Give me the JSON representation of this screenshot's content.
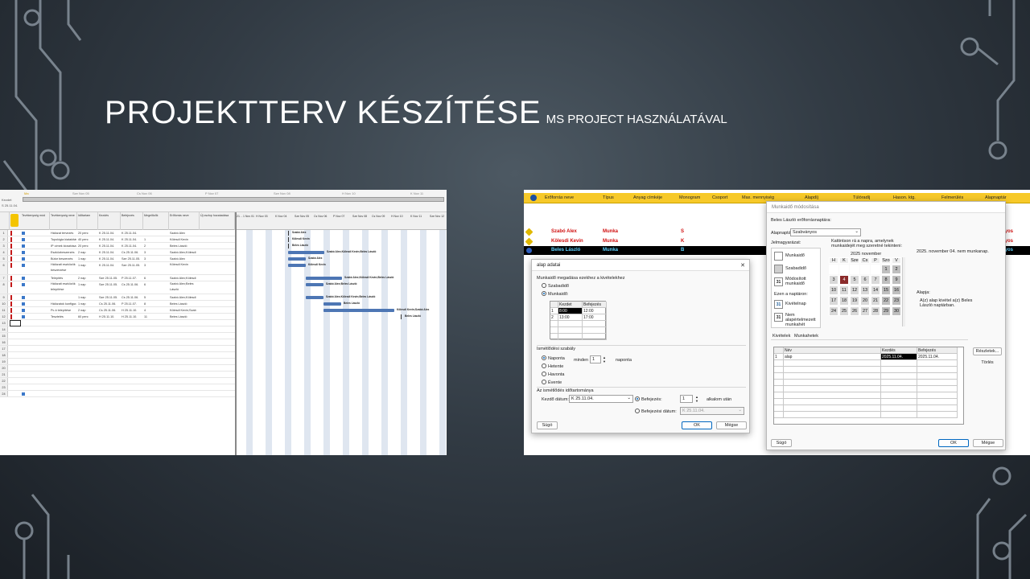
{
  "slide": {
    "title_main": "PROJEKTTERV KÉSZÍTÉSE",
    "title_sub": "MS PROJECT HASZNÁLATÁVAL"
  },
  "left_screenshot": {
    "timeline_start_label": "Kezdet",
    "timeline_start_date": "S 25.11.04.",
    "timeline_dates": [
      "Ma",
      "Sze Nov 05",
      "Cs Nov 06",
      "P Nov 07",
      "Sze Nov 08",
      "H Nov 10",
      "K Nov 11"
    ],
    "columns": [
      "Tevékenység mód",
      "Tevékenység neve",
      "Időtartam",
      "Kezdés",
      "Befejezés",
      "Megelőzők",
      "Erőforrás neve",
      "Új oszlop hozzáadása"
    ],
    "gantt_head": [
      "21. - 1 Nov 01",
      "H Nov 03",
      "K Nov 04",
      "Sze Nov 05",
      "Cs Nov 06",
      "P Nov 07",
      "Sze Nov 08",
      "Cs Nov 09",
      "H Nov 10",
      "K Nov 11",
      "Sze Nov 12"
    ],
    "tasks": [
      {
        "n": "1",
        "name": "Hálózat tervezés",
        "dur": "20 perc",
        "start": "K 25.11.04.",
        "end": "K 25.11.04.",
        "pred": "",
        "res": "Szabó Alex"
      },
      {
        "n": "2",
        "name": "Topológia kialakítása",
        "dur": "40 perc",
        "start": "K 25.11.04.",
        "end": "K 25.11.04.",
        "pred": "1",
        "res": "Kölesdi Kevin"
      },
      {
        "n": "3",
        "name": "IP címek kiosztása",
        "dur": "20 perc",
        "start": "K 25.11.04.",
        "end": "K 25.11.04.",
        "pred": "2",
        "res": "Beles László"
      },
      {
        "n": "4",
        "name": "Eszközbeszerzés",
        "dur": "2 nap",
        "start": "K 25.11.04.",
        "end": "Cs 25.11.06.",
        "pred": "3",
        "res": "Szabó Alex;Kölesdi"
      },
      {
        "n": "5",
        "name": "Bútor beszerzés",
        "dur": "1 nap",
        "start": "K 25.11.04.",
        "end": "Sze 25.11.05.",
        "pred": "3",
        "res": "Szabó Alex"
      },
      {
        "n": "6",
        "name": "Hálózati eszközök beszerzése",
        "dur": "1 nap",
        "start": "K 25.11.04.",
        "end": "Sze 25.11.05.",
        "pred": "3",
        "res": "Kölesdi Kevin"
      },
      {
        "n": "7",
        "name": "Telepítés",
        "dur": "2 nap",
        "start": "Sze 25.11.05.",
        "end": "P 25.11.07.",
        "pred": "6",
        "res": "Szabó Alex;Kölesdi"
      },
      {
        "n": "8",
        "name": "Hálózati eszközök telepítése",
        "dur": "1 nap",
        "start": "Sze 25.11.05.",
        "end": "Cs 25.11.06.",
        "pred": "6",
        "res": "Szabó Alex;Beles László"
      },
      {
        "n": "9",
        "name": "",
        "dur": "1 nap",
        "start": "Sze 25.11.05.",
        "end": "Cs 25.11.06.",
        "pred": "5",
        "res": "Szabó Alex;Kölesdi"
      },
      {
        "n": "10",
        "name": "Hálózatok konfigurálása",
        "dur": "1 nap",
        "start": "Cs 25.11.06.",
        "end": "P 25.11.07.",
        "pred": "8",
        "res": "Beles László"
      },
      {
        "n": "11",
        "name": "Pc-k telepítése",
        "dur": "2 nap",
        "start": "Cs 25.11.06.",
        "end": "H 25.11.10.",
        "pred": "4",
        "res": "Kölesdi Kevin;Szab"
      },
      {
        "n": "12",
        "name": "Tesztelés",
        "dur": "60 perc",
        "start": "H 25.11.10.",
        "end": "H 25.11.10.",
        "pred": "11",
        "res": "Beles László"
      }
    ],
    "empty_rows": [
      "13",
      "14",
      "15",
      "16",
      "17",
      "18",
      "19",
      "20",
      "21",
      "22",
      "23",
      "24"
    ],
    "gantt_labels": [
      "Szabó Alex",
      "Kölesdi Kevin",
      "Beles László",
      "Szabó Alex;Kölesdi Kevin;Beles László",
      "Szabó Alex",
      "Kölesdi Kevin",
      "Szabó Alex;Kölesdi Kevin;Beles László",
      "Szabó Alex;Beles László",
      "Szabó Alex;Kölesdi Kevin;Beles László",
      "Beles László",
      "Kölesdi Kevin;Szabó Alex",
      "Beles László"
    ]
  },
  "right_screenshot": {
    "resource_columns": [
      "Erőforrás neve",
      "Típus",
      "Anyag címkéje",
      "Monogram",
      "Csoport",
      "Max. mennyiség",
      "Alapdíj",
      "Túlóradíj",
      "Hason. ktg.",
      "Felmerülés",
      "Alapnaptár"
    ],
    "resources": [
      {
        "name": "Szabó Alex",
        "type": "Munka",
        "mono": "S",
        "right": "nyos"
      },
      {
        "name": "Kölesdi Kevin",
        "type": "Munka",
        "mono": "K",
        "right": "nyos"
      },
      {
        "name": "Beles László",
        "type": "Munka",
        "mono": "B",
        "right": "nyos"
      }
    ],
    "change_dialog": {
      "title": "Munkaidő módosítása",
      "subtitle": "Beles László erőforrásnaptára:",
      "base_label": "Alapnaptár:",
      "base_value": "Szabványos",
      "legend_title": "Jelmagyarázat:",
      "legend": [
        "Munkaidő",
        "Szabadidő",
        "Módosított munkaidő"
      ],
      "legend_num": "31",
      "on_calendar": "Ezen a naptáron:",
      "exception_day": "Kivételnap",
      "nondefault_week": "Nem alapértelmezett munkahét",
      "instructions": "Kattintson rá a napra, amelynek munkaidejét meg szeretné tekinteni:",
      "month": "2025 november",
      "weekdays": [
        "H",
        "K",
        "Sze",
        "Cs",
        "P",
        "Szo",
        "V"
      ],
      "info_text": "2025. november 04. nem munkanap.",
      "basis_label": "Alapja:",
      "basis_text": "A(z) alap kivétel a(z) Beles László naptárban.",
      "tabs": [
        "Kivételek",
        "Munkahetek"
      ],
      "table_cols": [
        "Név",
        "Kezdés",
        "Befejezés"
      ],
      "row_n": "1",
      "row_name": "alap",
      "row_start": "2025.11.04.",
      "row_end": "2025.11.04.",
      "details_btn": "Részletek...",
      "delete_btn": "Törlés",
      "help_btn": "Súgó",
      "ok_btn": "OK",
      "cancel_btn": "Mégse"
    },
    "details_dialog": {
      "title": "alap adatai",
      "section1": "Munkaidő megadása ezekhez a kivételekhez",
      "opt_free": "Szabadidő",
      "opt_work": "Munkaidő:",
      "time_cols": [
        "Kezdet",
        "Befejezés"
      ],
      "time_rows": [
        {
          "n": "1",
          "from": "8:00",
          "to": "12:00"
        },
        {
          "n": "2",
          "from": "13:00",
          "to": "17:00"
        }
      ],
      "section2": "Ismétlődési szabály",
      "recur": [
        "Naponta",
        "Hetente",
        "Havonta",
        "Évente"
      ],
      "every_label": "minden",
      "every_value": "1",
      "every_unit": "naponta",
      "section3": "Az ismétlődés időtartománya",
      "start_label": "Kezdő dátum:",
      "start_value": "K 25.11.04.",
      "end_after_label": "Befejezés:",
      "end_after_value": "1",
      "end_after_unit": "alkalom után",
      "end_date_label": "Befejezési dátum:",
      "end_date_value": "K 25.11.04.",
      "help_btn": "Súgó",
      "ok_btn": "OK",
      "cancel_btn": "Mégse"
    }
  }
}
